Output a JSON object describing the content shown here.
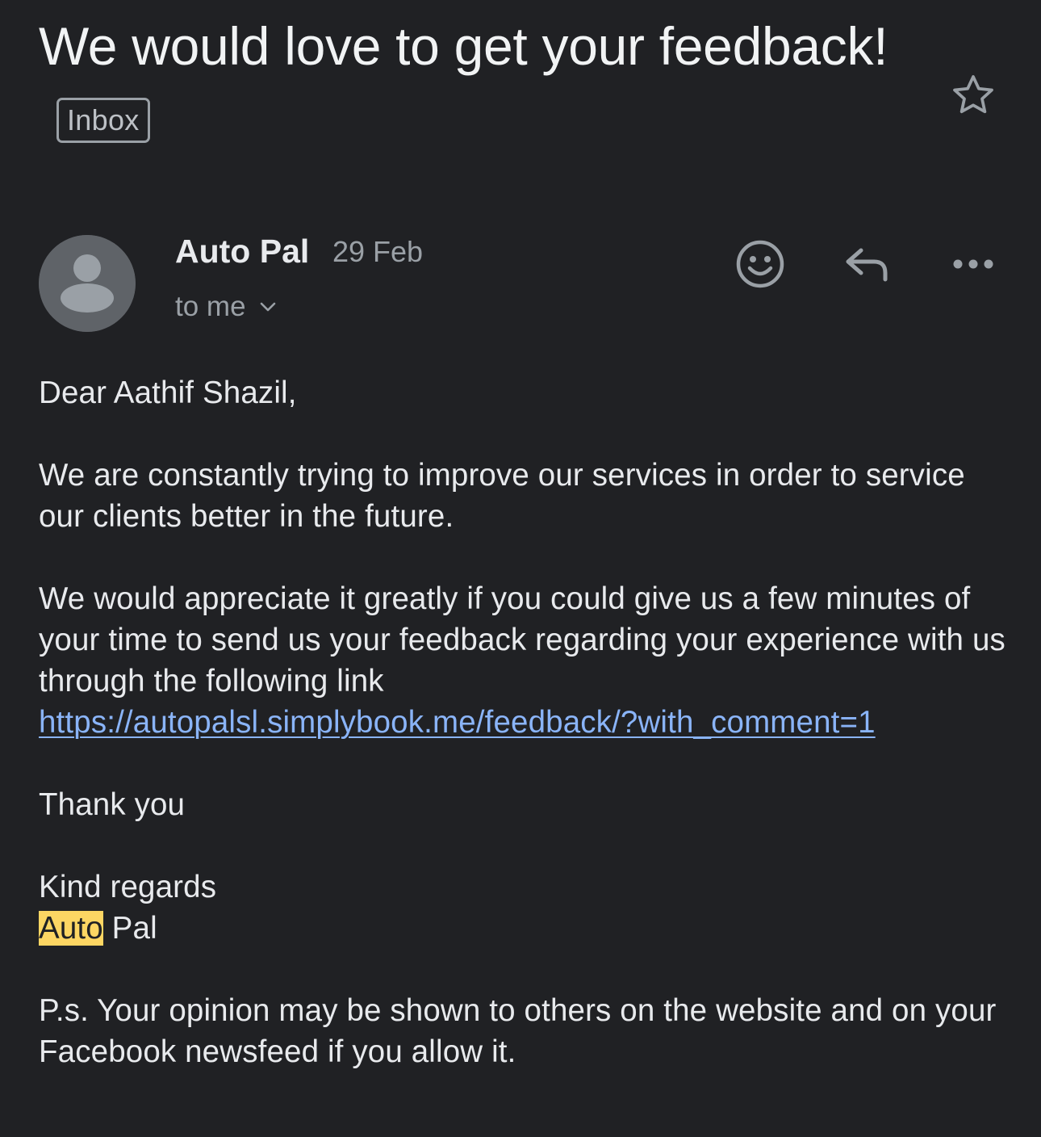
{
  "subject": {
    "text": "We would love to get your feedback!",
    "label": "Inbox"
  },
  "message": {
    "sender": "Auto Pal",
    "date": "29 Feb",
    "recipient": "to me"
  },
  "icons": {
    "star": "star-outline-icon",
    "avatar": "default-person-avatar",
    "recipient_toggle": "chevron-down-icon",
    "emoji": "emoji-reaction-icon",
    "reply": "reply-icon",
    "more": "more-horizontal-icon"
  },
  "body": {
    "greeting": "Dear Aathif Shazil,",
    "paragraph1": "We are constantly trying to improve our services in order to service our clients better in the future.",
    "paragraph2": "We would appreciate it greatly if you could give us a few minutes of your time to send us your feedback regarding your experience with us through the following link",
    "link": "https://autopalsl.simplybook.me/feedback/?with_comment=1",
    "thanks": "Thank you",
    "closing": "Kind regards",
    "signature_highlighted": "Auto",
    "signature_rest": "Pal",
    "ps": "P.s. Your opinion may be shown to others on the website and on your Facebook newsfeed if you allow it."
  },
  "colors": {
    "background": "#202124",
    "text": "#e8eaed",
    "muted": "#9aa0a6",
    "link": "#8ab4f8",
    "highlight": "#fdd663",
    "avatar_bg": "#5f6368"
  }
}
